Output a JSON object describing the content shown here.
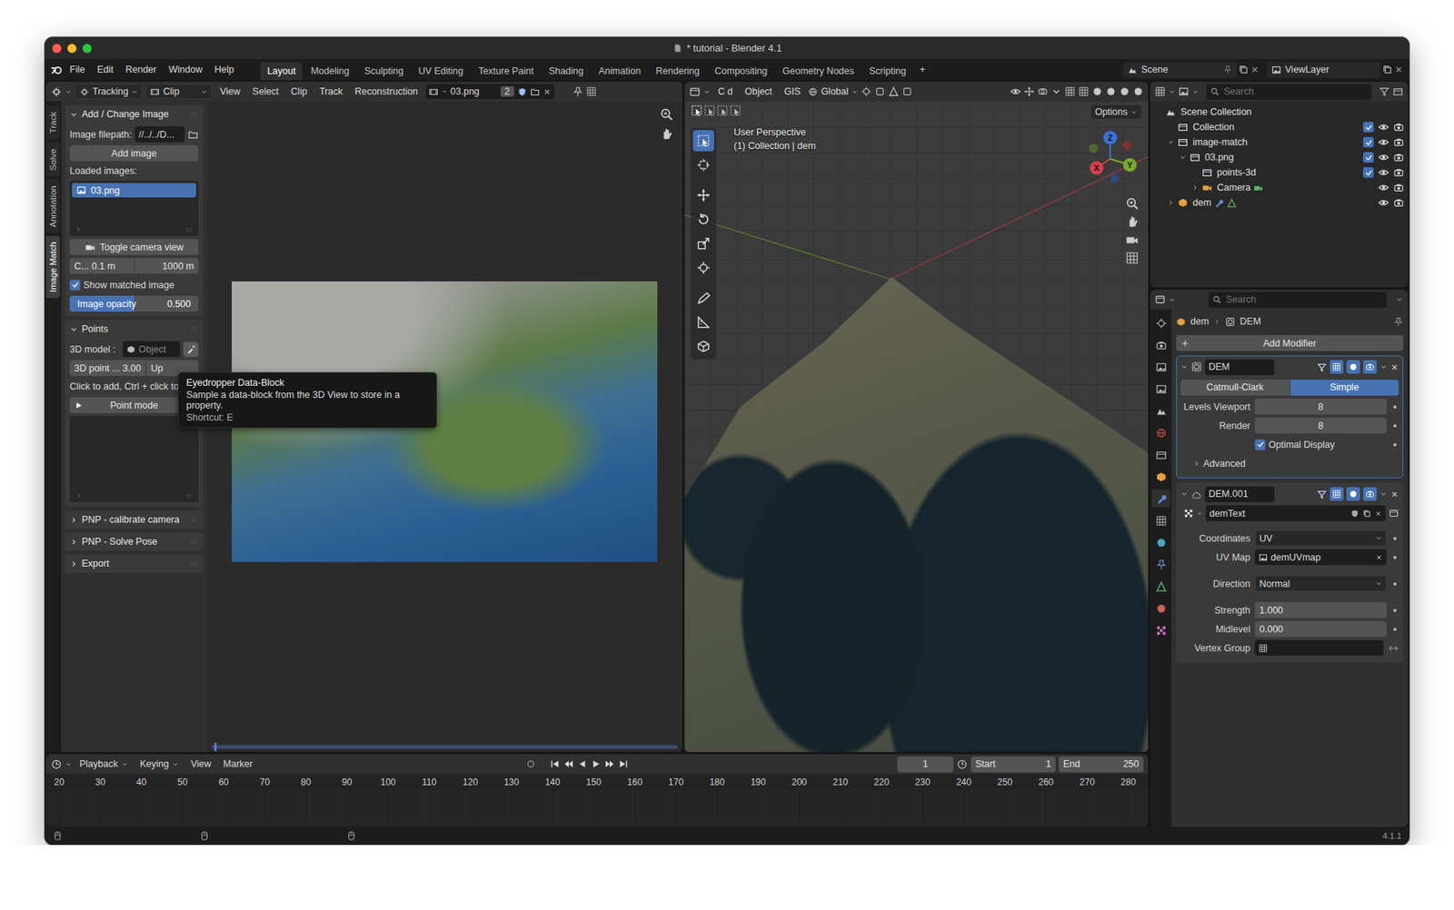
{
  "window": {
    "title": "* tutorial - Blender 4.1"
  },
  "menu_bar": {
    "items": [
      "File",
      "Edit",
      "Render",
      "Window",
      "Help"
    ],
    "workspaces": [
      {
        "label": "Layout",
        "selected": true
      },
      {
        "label": "Modeling",
        "selected": false
      },
      {
        "label": "Sculpting",
        "selected": false
      },
      {
        "label": "UV Editing",
        "selected": false
      },
      {
        "label": "Texture Paint",
        "selected": false
      },
      {
        "label": "Shading",
        "selected": false
      },
      {
        "label": "Animation",
        "selected": false
      },
      {
        "label": "Rendering",
        "selected": false
      },
      {
        "label": "Compositing",
        "selected": false
      },
      {
        "label": "Geometry Nodes",
        "selected": false
      },
      {
        "label": "Scripting",
        "selected": false
      }
    ],
    "add_workspace": "+",
    "scene": "Scene",
    "view_layer": "ViewLayer"
  },
  "clip_header": {
    "mode": "Tracking",
    "view": "Clip",
    "menus": [
      "View",
      "Select",
      "Clip",
      "Track",
      "Reconstruction"
    ],
    "clip": "03.png",
    "users": "2"
  },
  "viewport_header": {
    "menus": [
      "C d",
      "Object",
      "GIS"
    ],
    "orientation": "Global"
  },
  "side_tabs": [
    {
      "label": "Track",
      "selected": false
    },
    {
      "label": "Solve",
      "selected": false
    },
    {
      "label": "Annotation",
      "selected": false
    },
    {
      "label": "Image Match",
      "selected": true
    }
  ],
  "image_panel": {
    "title": "Add / Change Image",
    "expanded": true,
    "filepath_label": "Image filepath:",
    "filepath": "//../../D...",
    "add_button": "Add image",
    "loaded_label": "Loaded images:",
    "images": [
      {
        "name": "03.png",
        "selected": true
      }
    ],
    "toggle_camera": "Toggle camera view",
    "clip_start": "C...  0.1 m",
    "clip_end": "1000 m",
    "show_matched": {
      "label": "Show matched image",
      "checked": true
    },
    "opacity": {
      "label": "Image opacity",
      "value": "0.500",
      "level": 0.5
    }
  },
  "points_panel": {
    "title": "Points",
    "expanded": true,
    "model_label": "3D model :",
    "model_placeholder": "Object",
    "point_size": "3D point ... 3.00",
    "up": "Up",
    "hint": "Click to add, Ctrl + click to",
    "point_mode": "Point mode"
  },
  "collapsed_panels": [
    {
      "title": "PNP - calibrate camera",
      "expanded": false
    },
    {
      "title": "PNP - Solve Pose",
      "expanded": false
    },
    {
      "title": "Export",
      "expanded": false
    }
  ],
  "tooltip": {
    "title": "Eyedropper Data-Block",
    "description": "Sample a data-block from the 3D View to store in a property.",
    "shortcut": "Shortcut: E"
  },
  "viewport": {
    "perspective": "User Perspective",
    "context": "(1) Collection | dem",
    "options": "Options",
    "axes": [
      {
        "label": "Z",
        "color": "#3d6fd8"
      },
      {
        "label": "Y",
        "color": "#7bab2a"
      },
      {
        "label": "X",
        "color": "#d8404a"
      }
    ],
    "tools": [
      {
        "selected": true
      },
      {
        "selected": false
      },
      {
        "selected": false
      },
      {
        "selected": false
      },
      {
        "selected": false
      },
      {
        "selected": false
      },
      {
        "selected": false
      },
      {
        "selected": false
      },
      {
        "selected": false
      }
    ]
  },
  "outliner": {
    "search_placeholder": "Search",
    "items": [
      {
        "label": "Scene Collection",
        "depth": 0,
        "kind": "scene"
      },
      {
        "label": "Collection",
        "depth": 1,
        "kind": "collection",
        "checked": true
      },
      {
        "label": "image-match",
        "depth": 1,
        "kind": "collection",
        "expanded": true,
        "checked": true
      },
      {
        "label": "03.png",
        "depth": 2,
        "kind": "collection",
        "expanded": true,
        "checked": true
      },
      {
        "label": "points-3d",
        "depth": 3,
        "kind": "collection",
        "checked": true
      },
      {
        "label": "Camera",
        "depth": 3,
        "kind": "camera",
        "expanded": false
      },
      {
        "label": "dem",
        "depth": 1,
        "kind": "mesh",
        "expanded": false
      }
    ]
  },
  "properties": {
    "search_placeholder": "Search",
    "tabs": [
      {
        "selected": false
      },
      {
        "selected": false
      },
      {
        "selected": false
      },
      {
        "selected": false
      },
      {
        "selected": false
      },
      {
        "selected": false
      },
      {
        "selected": false
      },
      {
        "selected": false
      },
      {
        "selected": true
      },
      {
        "selected": false
      },
      {
        "selected": false
      },
      {
        "selected": false
      },
      {
        "selected": false
      },
      {
        "selected": false
      },
      {
        "selected": false
      }
    ],
    "breadcrumb": [
      "dem",
      "DEM"
    ],
    "add_modifier": "Add Modifier",
    "modifiers": [
      {
        "kind": "subsurf",
        "name": "DEM",
        "active": true,
        "expanded": true,
        "modes": [
          {
            "label": "Catmull-Clark",
            "selected": false
          },
          {
            "label": "Simple",
            "selected": true
          }
        ],
        "fields": [
          {
            "label": "Levels Viewport",
            "value": "8"
          },
          {
            "label": "Render",
            "value": "8"
          }
        ],
        "checkbox": {
          "label": "Optimal Display",
          "checked": true
        },
        "advanced": {
          "label": "Advanced",
          "expanded": false
        }
      },
      {
        "kind": "displace",
        "name": "DEM.001",
        "active": false,
        "expanded": true,
        "texture": "demText",
        "fields": [
          {
            "label": "Coordinates",
            "value": "UV",
            "kind": "dropdown"
          },
          {
            "label": "UV Map",
            "value": "demUVmap",
            "kind": "search"
          },
          {
            "label": "Direction",
            "value": "Normal",
            "kind": "dropdown"
          },
          {
            "label": "Strength",
            "value": "1.000",
            "kind": "number"
          },
          {
            "label": "Midlevel",
            "value": "0.000",
            "kind": "number"
          },
          {
            "label": "Vertex Group",
            "kind": "search"
          }
        ]
      }
    ]
  },
  "timeline": {
    "menus": [
      "Playback",
      "Keying",
      "View",
      "Marker"
    ],
    "frame": "1",
    "start_label": "Start",
    "start": "1",
    "end_label": "End",
    "end": "250",
    "ticks": [
      "20",
      "30",
      "40",
      "50",
      "60",
      "70",
      "80",
      "90",
      "100",
      "110",
      "120",
      "130",
      "140",
      "150",
      "160",
      "170",
      "180",
      "190",
      "200",
      "210",
      "220",
      "230",
      "240",
      "250",
      "260",
      "270",
      "280"
    ]
  },
  "status_bar": {
    "version": "4.1.1"
  }
}
